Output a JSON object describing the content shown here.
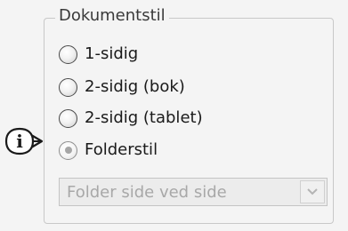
{
  "group": {
    "title": "Dokumentstil",
    "options": [
      {
        "label": "1-sidig",
        "selected": false
      },
      {
        "label": "2-sidig (bok)",
        "selected": false
      },
      {
        "label": "2-sidig (tablet)",
        "selected": false
      },
      {
        "label": "Folderstil",
        "selected": true
      }
    ]
  },
  "info_pointer": {
    "icon": "info-icon",
    "glyph": "i"
  },
  "folder_style_select": {
    "value": "Folder side ved side",
    "enabled": false
  }
}
